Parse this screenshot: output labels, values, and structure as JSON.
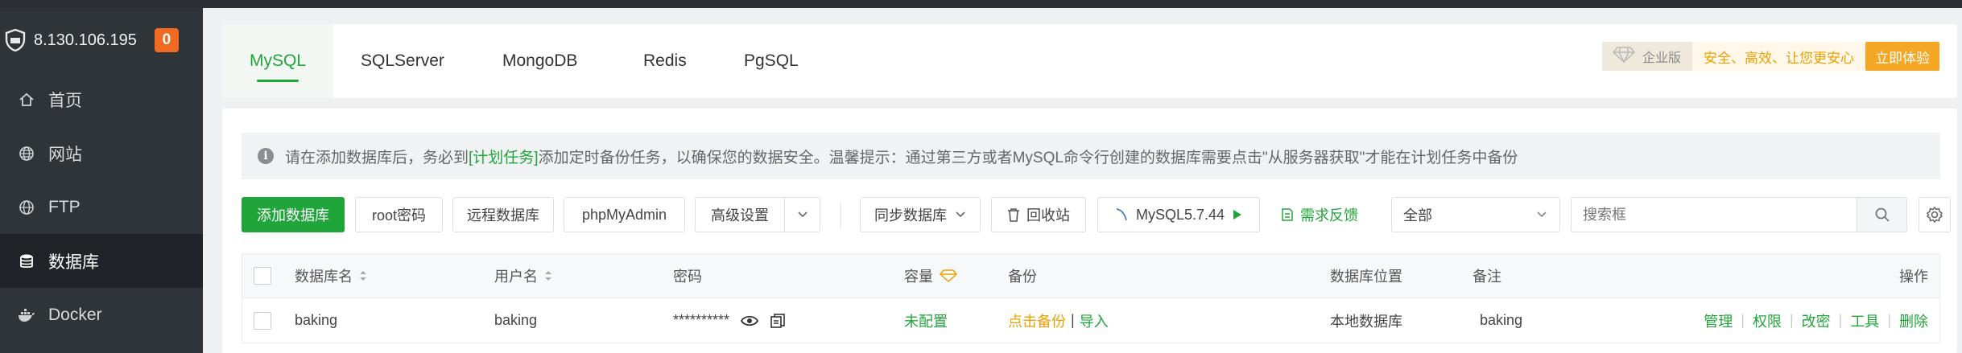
{
  "sidebar": {
    "server_ip": "8.130.106.195",
    "notify_count": "0",
    "items": [
      {
        "label": "首页",
        "icon": "home-icon"
      },
      {
        "label": "网站",
        "icon": "globe-icon"
      },
      {
        "label": "FTP",
        "icon": "globe-icon"
      },
      {
        "label": "数据库",
        "icon": "database-icon"
      },
      {
        "label": "Docker",
        "icon": "docker-icon"
      }
    ]
  },
  "tabs": [
    "MySQL",
    "SQLServer",
    "MongoDB",
    "Redis",
    "PgSQL"
  ],
  "promo": {
    "edition": "企业版",
    "slogan": "安全、高效、让您更安心",
    "cta": "立即体验"
  },
  "notice": {
    "prefix": "请在添加数据库后，务必到",
    "link": "[计划任务]",
    "suffix": "添加定时备份任务，以确保您的数据安全。温馨提示：通过第三方或者MySQL命令行创建的数据库需要点击\"从服务器获取\"才能在计划任务中备份"
  },
  "toolbar": {
    "add_db": "添加数据库",
    "root_pwd": "root密码",
    "remote_db": "远程数据库",
    "phpmyadmin": "phpMyAdmin",
    "advanced": "高级设置",
    "sync_db": "同步数据库",
    "recycle": "回收站",
    "mysql_version": "MySQL5.7.44",
    "feedback": "需求反馈",
    "filter_value": "全部",
    "search_placeholder": "搜索框"
  },
  "table": {
    "headers": {
      "name": "数据库名",
      "user": "用户名",
      "password": "密码",
      "capacity": "容量",
      "backup": "备份",
      "location": "数据库位置",
      "note": "备注",
      "actions": "操作"
    },
    "rows": [
      {
        "name": "baking",
        "user": "baking",
        "password": "**********",
        "capacity": "未配置",
        "backup_action": "点击备份",
        "backup_sep": "|",
        "import": "导入",
        "location": "本地数据库",
        "note": "baking",
        "ops": [
          "管理",
          "权限",
          "改密",
          "工具",
          "删除"
        ]
      }
    ]
  },
  "colors": {
    "accent": "#20a53a",
    "sidebar_bg": "#2f3438",
    "warning": "#f0a000",
    "badge": "#f06a22"
  }
}
